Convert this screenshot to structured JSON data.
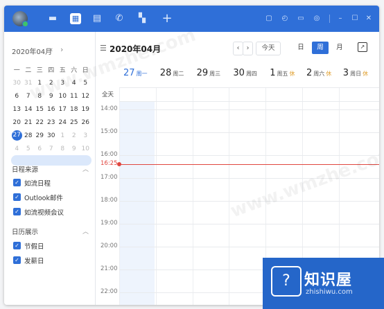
{
  "toolbar": {
    "icons": [
      "chat-icon",
      "calendar-icon",
      "contacts-icon",
      "phone-icon",
      "apps-icon",
      "plus-icon"
    ],
    "right_icons": [
      "note-icon",
      "history-icon",
      "folder-icon",
      "settings-icon"
    ],
    "window_controls": [
      "minimize-icon",
      "maximize-icon",
      "close-icon"
    ]
  },
  "mini_calendar": {
    "title": "2020年04月",
    "weekdays": [
      "一",
      "二",
      "三",
      "四",
      "五",
      "六",
      "日"
    ],
    "weeks": [
      [
        "30",
        "31",
        "1",
        "2",
        "3",
        "4",
        "5"
      ],
      [
        "6",
        "7",
        "8",
        "9",
        "10",
        "11",
        "12"
      ],
      [
        "13",
        "14",
        "15",
        "16",
        "17",
        "18",
        "19"
      ],
      [
        "20",
        "21",
        "22",
        "23",
        "24",
        "25",
        "26"
      ],
      [
        "27",
        "28",
        "29",
        "30",
        "1",
        "2",
        "3"
      ],
      [
        "4",
        "5",
        "6",
        "7",
        "8",
        "9",
        "10"
      ]
    ]
  },
  "sources": {
    "title": "日程来源",
    "items": [
      "如流日程",
      "Outlook邮件",
      "如流视频会议"
    ]
  },
  "display": {
    "title": "日历展示",
    "items": [
      "节假日",
      "发薪日"
    ]
  },
  "header": {
    "title": "2020年04月",
    "today_label": "今天",
    "views": [
      "日",
      "周",
      "月"
    ],
    "active_view": "周"
  },
  "days": [
    {
      "num": "27",
      "wk": "周一",
      "rest": ""
    },
    {
      "num": "28",
      "wk": "周二",
      "rest": ""
    },
    {
      "num": "29",
      "wk": "周三",
      "rest": ""
    },
    {
      "num": "30",
      "wk": "周四",
      "rest": ""
    },
    {
      "num": "1",
      "wk": "周五",
      "rest": "休"
    },
    {
      "num": "2",
      "wk": "周六",
      "rest": "休"
    },
    {
      "num": "3",
      "wk": "周日",
      "rest": "休"
    }
  ],
  "allday_label": "全天",
  "hours": [
    "14:00",
    "15:00",
    "16:00",
    "17:00",
    "18:00",
    "19:00",
    "20:00",
    "21:00",
    "22:00"
  ],
  "now_time": "16:25",
  "brand": {
    "title": "知识屋",
    "sub": "zhishiwu.com"
  },
  "watermark": "www.wmzhe.com",
  "colors": {
    "accent": "#2f6fd8",
    "now": "#e0463f",
    "rest": "#e0a030"
  }
}
